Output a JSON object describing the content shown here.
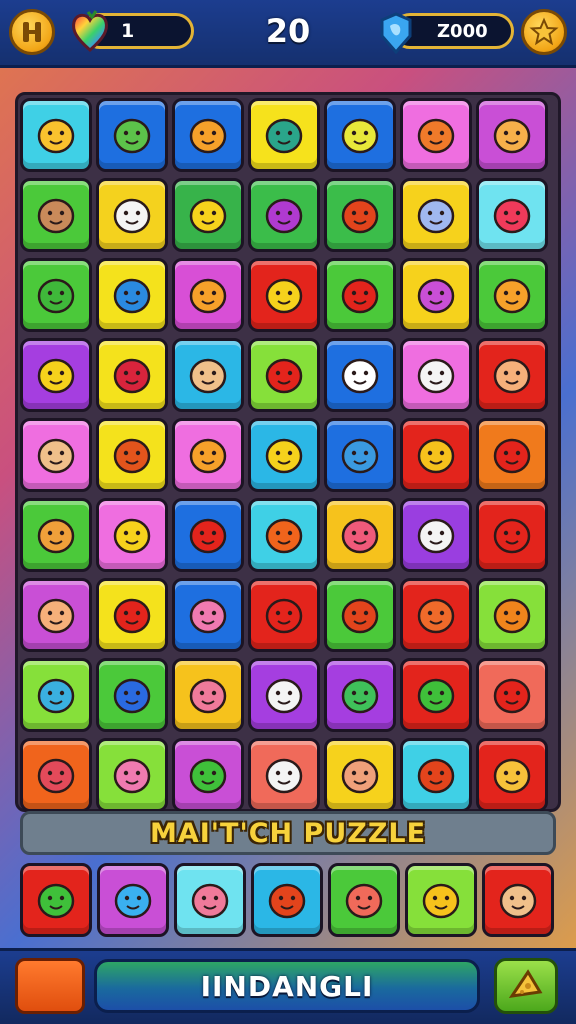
{
  "hud": {
    "hearts_count": "1",
    "score": "20",
    "gems_count": "Z000",
    "pause_icon": "pause-icon",
    "star_icon": "star-icon"
  },
  "board": {
    "rows": [
      [
        {
          "icon": "sun-face",
          "color": "#3fd0e6"
        },
        {
          "icon": "green-monster",
          "color": "#1e6fe0"
        },
        {
          "icon": "smiley-ball",
          "color": "#1e6fe0"
        },
        {
          "icon": "cone-stack",
          "color": "#f6e21c"
        },
        {
          "icon": "yellow-block",
          "color": "#1e6fe0"
        },
        {
          "icon": "pencil",
          "color": "#ef6ee0"
        },
        {
          "icon": "girl-face",
          "color": "#c94fd6"
        }
      ],
      [
        {
          "icon": "boy-face",
          "color": "#4bc93a"
        },
        {
          "icon": "panda-face",
          "color": "#f4d21e"
        },
        {
          "icon": "lemon",
          "color": "#37b34a"
        },
        {
          "icon": "crossed-bats",
          "color": "#3bbd4a"
        },
        {
          "icon": "red-bar",
          "color": "#3bbd4a"
        },
        {
          "icon": "teapot",
          "color": "#f6d21c"
        },
        {
          "icon": "balloon",
          "color": "#6fe3f0"
        }
      ],
      [
        {
          "icon": "green-cone",
          "color": "#4bc93a"
        },
        {
          "icon": "blue-ring",
          "color": "#f4e21c"
        },
        {
          "icon": "orange-critter",
          "color": "#d84fd6"
        },
        {
          "icon": "yellow-smiley",
          "color": "#e3241c"
        },
        {
          "icon": "strawberry",
          "color": "#4bc93a"
        },
        {
          "icon": "crossed-pencils",
          "color": "#f6d21c"
        },
        {
          "icon": "scroll",
          "color": "#4bc93a"
        }
      ],
      [
        {
          "icon": "yellow-cat",
          "color": "#a53ee0"
        },
        {
          "icon": "red-fish",
          "color": "#f4e21c"
        },
        {
          "icon": "boy-portrait",
          "color": "#2bb7e6"
        },
        {
          "icon": "red-splat",
          "color": "#86e03a"
        },
        {
          "icon": "water-drop",
          "color": "#1e6fe0"
        },
        {
          "icon": "shell-flower",
          "color": "#ef6ee0"
        },
        {
          "icon": "chef-face",
          "color": "#e3241c"
        }
      ],
      [
        {
          "icon": "boy-bust",
          "color": "#ef6ee0"
        },
        {
          "icon": "no-sign",
          "color": "#f4e21c"
        },
        {
          "icon": "orange-candy",
          "color": "#ef6ee0"
        },
        {
          "icon": "banana",
          "color": "#2bb7e6"
        },
        {
          "icon": "blue-fish",
          "color": "#1e6fe0"
        },
        {
          "icon": "mango",
          "color": "#e3241c"
        },
        {
          "icon": "cherry-face",
          "color": "#f07a1c"
        }
      ],
      [
        {
          "icon": "orange-blob",
          "color": "#4bc93a"
        },
        {
          "icon": "yellow-bird",
          "color": "#ef6ee0"
        },
        {
          "icon": "heart",
          "color": "#1e6fe0"
        },
        {
          "icon": "orange-sun",
          "color": "#3fd0e6"
        },
        {
          "icon": "popsicle",
          "color": "#f6c21c"
        },
        {
          "icon": "sheep",
          "color": "#9a3ee0"
        },
        {
          "icon": "radish",
          "color": "#e3241c"
        }
      ],
      [
        {
          "icon": "teddy-face",
          "color": "#c94fd6"
        },
        {
          "icon": "red-crab",
          "color": "#f4e21c"
        },
        {
          "icon": "pink-popsicle",
          "color": "#1e6fe0"
        },
        {
          "icon": "apple",
          "color": "#e3241c"
        },
        {
          "icon": "pepper",
          "color": "#4bc93a"
        },
        {
          "icon": "crayon",
          "color": "#e3241c"
        },
        {
          "icon": "orange-ghost",
          "color": "#86e03a"
        }
      ],
      [
        {
          "icon": "blue-bat",
          "color": "#86e03a"
        },
        {
          "icon": "blue-pen",
          "color": "#4bc93a"
        },
        {
          "icon": "pink-fish",
          "color": "#f6c21c"
        },
        {
          "icon": "white-ghost",
          "color": "#a53ee0"
        },
        {
          "icon": "green-cupcake",
          "color": "#a53ee0"
        },
        {
          "icon": "green-bean",
          "color": "#e3241c"
        },
        {
          "icon": "red-dragon",
          "color": "#f06a5a"
        }
      ],
      [
        {
          "icon": "red-dino",
          "color": "#f0641c"
        },
        {
          "icon": "pink-piglet",
          "color": "#86e03a"
        },
        {
          "icon": "green-leaf",
          "color": "#c94fd6"
        },
        {
          "icon": "chef-ghost",
          "color": "#f06a5a"
        },
        {
          "icon": "seed",
          "color": "#f6d21c"
        },
        {
          "icon": "paint-brush",
          "color": "#3fd0e6"
        },
        {
          "icon": "cheese",
          "color": "#e3241c"
        }
      ]
    ]
  },
  "banner": {
    "title": "MAI'T'CH PUZZLE"
  },
  "bottom_row": [
    {
      "icon": "green-alien",
      "color": "#e3241c"
    },
    {
      "icon": "blue-balloon",
      "color": "#c94fd6"
    },
    {
      "icon": "crowned-pig",
      "color": "#6fe3f0"
    },
    {
      "icon": "red-crayon",
      "color": "#2bb7e6"
    },
    {
      "icon": "red-blob",
      "color": "#4bc93a"
    },
    {
      "icon": "yellow-pot",
      "color": "#86e03a"
    },
    {
      "icon": "chef-girl",
      "color": "#e3241c"
    }
  ],
  "bottom_bar": {
    "main_label": "IINDANGLI",
    "right_icon": "cheese-wedge-icon"
  }
}
